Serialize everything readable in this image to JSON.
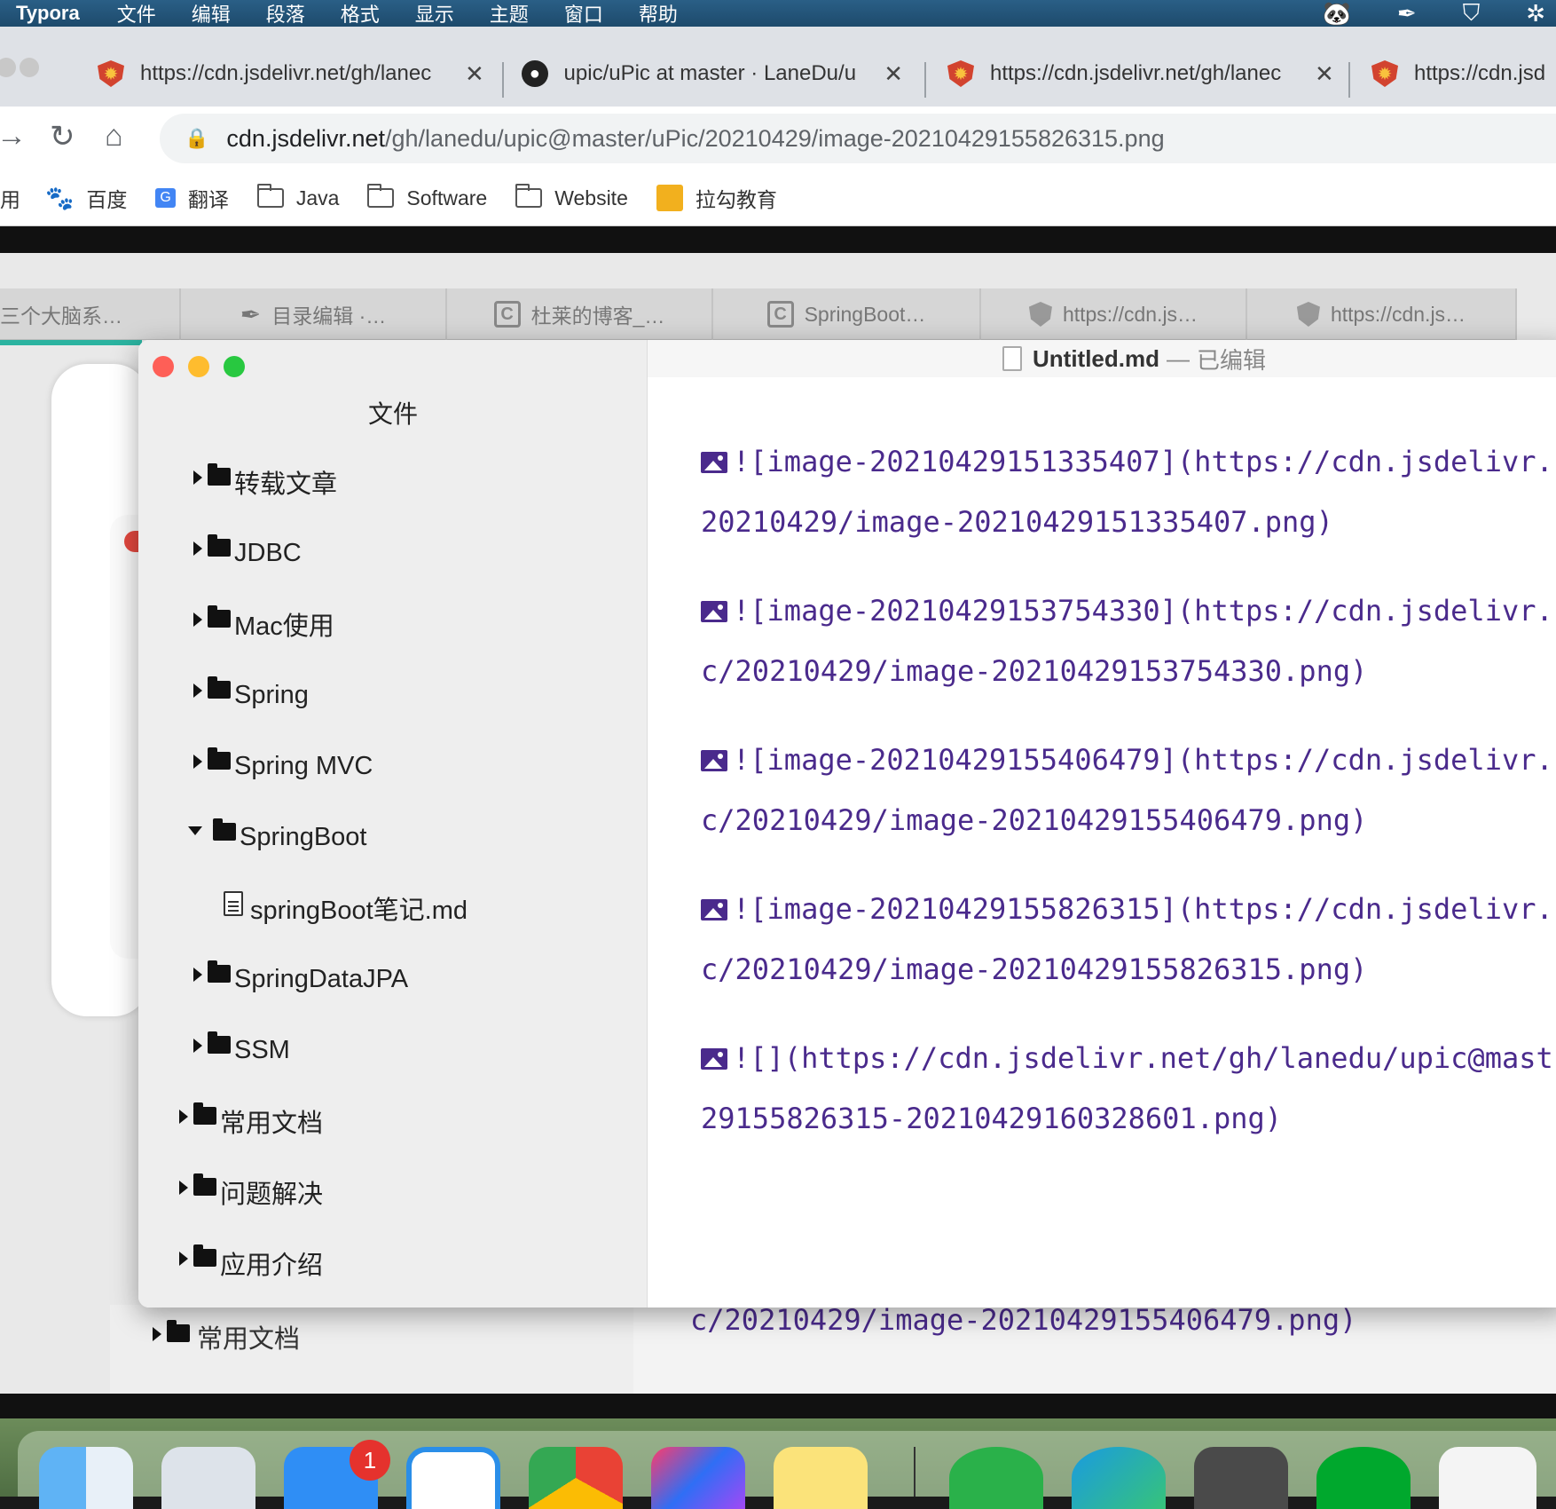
{
  "menubar": {
    "app": "Typora",
    "items": [
      "文件",
      "编辑",
      "段落",
      "格式",
      "显示",
      "主题",
      "窗口",
      "帮助"
    ]
  },
  "chrome": {
    "tabs": [
      {
        "title": "https://cdn.jsdelivr.net/gh/lanec",
        "icon": "shield-icon"
      },
      {
        "title": "upic/uPic at master · LaneDu/u",
        "icon": "github-icon"
      },
      {
        "title": "https://cdn.jsdelivr.net/gh/lanec",
        "icon": "shield-icon"
      },
      {
        "title": "https://cdn.jsd",
        "icon": "shield-icon"
      }
    ],
    "url_host": "cdn.jsdelivr.net",
    "url_path": "/gh/lanedu/upic@master/uPic/20210429/image-20210429155826315.png",
    "bookmarks": [
      "用",
      "百度",
      "翻译",
      "Java",
      "Software",
      "Website",
      "拉勾教育"
    ]
  },
  "bgwindow": {
    "tabs": [
      "三个大脑系…",
      "目录编辑 ·…",
      "杜莱的博客_…",
      "SpringBoot…",
      "https://cdn.js…",
      "https://cdn.js…"
    ],
    "sidebar_item": "常用文档",
    "content_line": "c/20210429/image-20210429155406479.png)"
  },
  "typora": {
    "sidebar_title": "文件",
    "tree": [
      {
        "label": "转载文章",
        "type": "folder",
        "open": false
      },
      {
        "label": "JDBC",
        "type": "folder",
        "open": false
      },
      {
        "label": "Mac使用",
        "type": "folder",
        "open": false
      },
      {
        "label": "Spring",
        "type": "folder",
        "open": false
      },
      {
        "label": "Spring MVC",
        "type": "folder",
        "open": false
      },
      {
        "label": "SpringBoot",
        "type": "folder",
        "open": true
      },
      {
        "label": "springBoot笔记.md",
        "type": "file"
      },
      {
        "label": "SpringDataJPA",
        "type": "folder",
        "open": false
      },
      {
        "label": "SSM",
        "type": "folder",
        "open": false
      },
      {
        "label": "常用文档",
        "type": "folder",
        "open": false
      },
      {
        "label": "问题解决",
        "type": "folder",
        "open": false
      },
      {
        "label": "应用介绍",
        "type": "folder",
        "open": false
      }
    ],
    "doc_title": "Untitled.md",
    "doc_sep": "—",
    "doc_status": "已编辑",
    "lines": [
      "![image-20210429151335407](https://cdn.jsdelivr.",
      "20210429/image-20210429151335407.png)",
      "![image-20210429153754330](https://cdn.jsdelivr.",
      "c/20210429/image-20210429153754330.png)",
      "![image-20210429155406479](https://cdn.jsdelivr.",
      "c/20210429/image-20210429155406479.png)",
      "![image-20210429155826315](https://cdn.jsdelivr.",
      "c/20210429/image-20210429155826315.png)",
      "![](https://cdn.jsdelivr.net/gh/lanedu/upic@mast",
      "29155826315-20210429160328601.png)"
    ]
  },
  "dock": {
    "badge": "1",
    "colors": {
      "menubar": "#1d4a6c",
      "link": "#4a2a8c",
      "close": "#fe5f57",
      "minimize": "#febc2e",
      "zoom": "#28c840"
    }
  }
}
